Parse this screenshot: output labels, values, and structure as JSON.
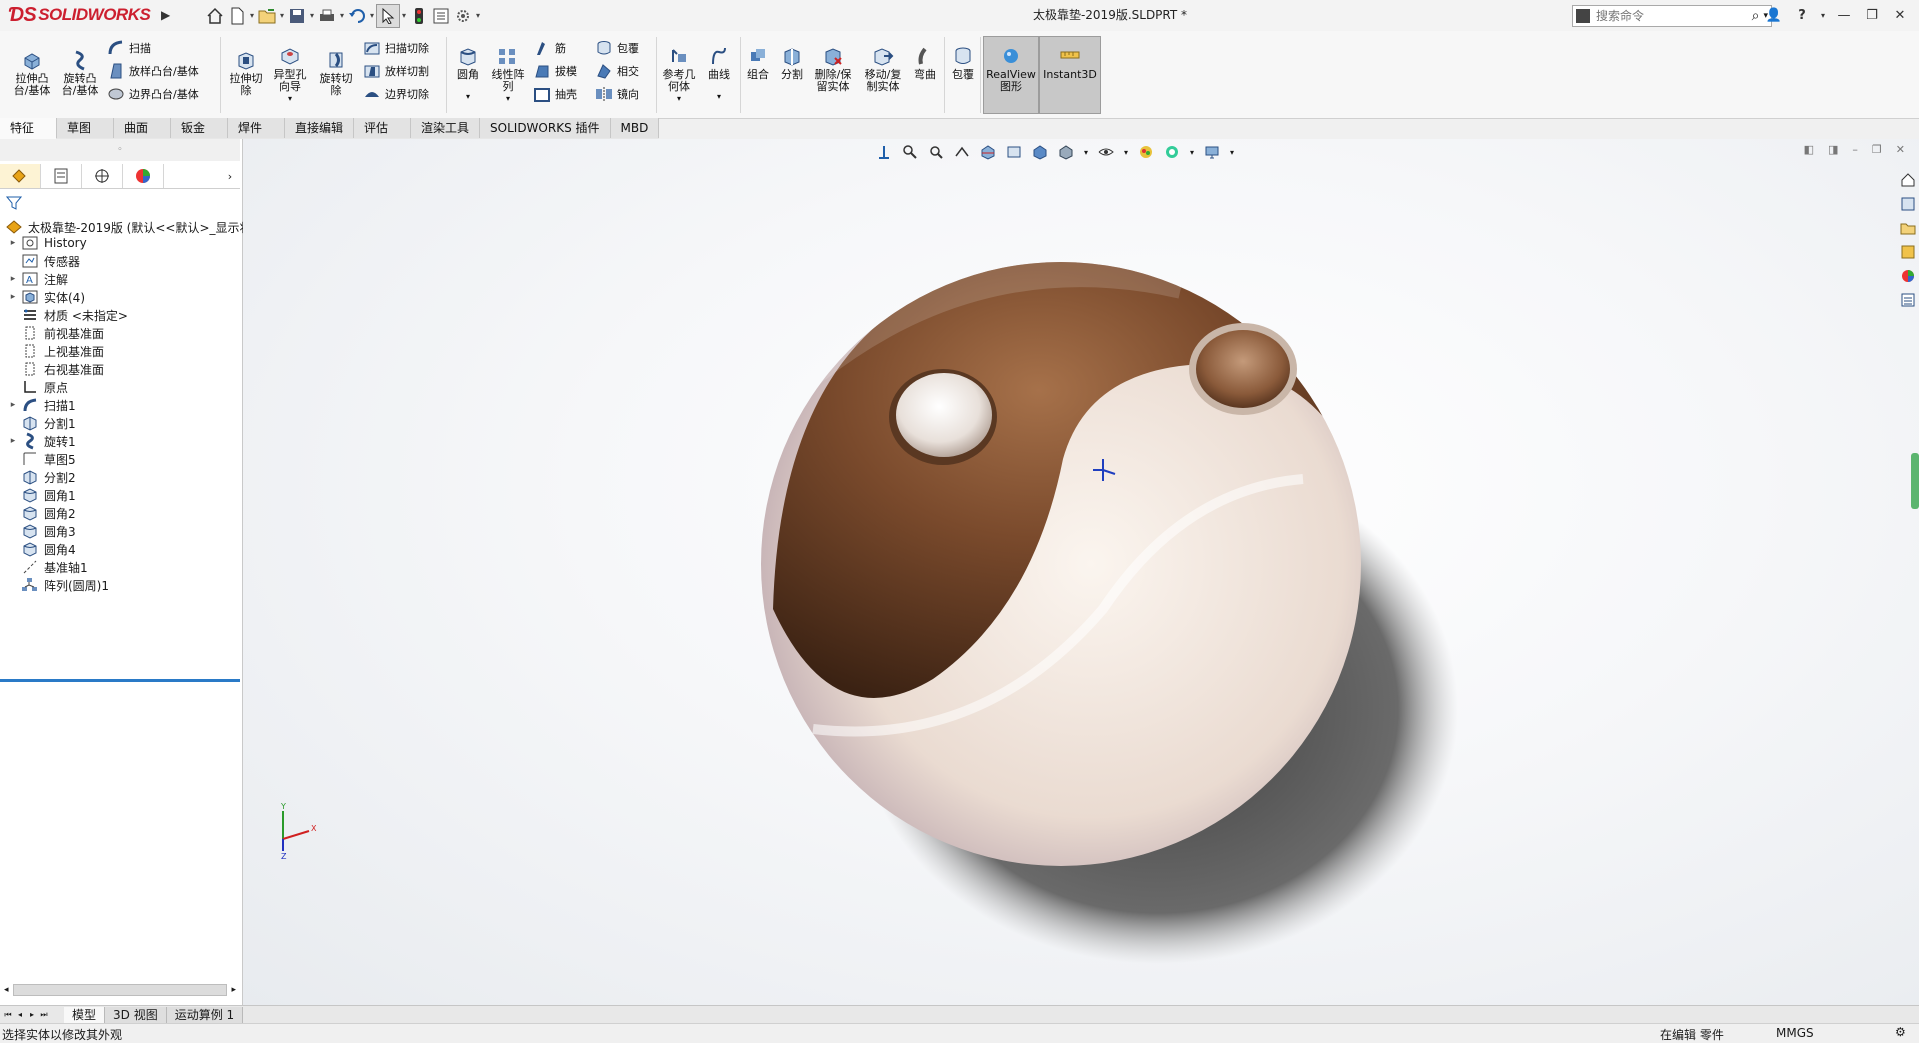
{
  "app": {
    "logo_text_solid": "SOLID",
    "logo_text_works": "WORKS",
    "document_title": "太极靠垫-2019版.SLDPRT *",
    "search_placeholder": "搜索命令"
  },
  "ribbon": {
    "extrude_boss": "拉伸凸\n台/基体",
    "revolve_boss": "旋转凸\n台/基体",
    "sweep": "扫描",
    "loft_boss": "放样凸台/基体",
    "boundary_boss": "边界凸台/基体",
    "extrude_cut": "拉伸切\n除",
    "hole_wizard": "异型孔\n向导",
    "revolve_cut": "旋转切\n除",
    "sweep_cut": "扫描切除",
    "loft_cut": "放样切割",
    "boundary_cut": "边界切除",
    "fillet": "圆角",
    "linear_pattern": "线性阵\n列",
    "rib": "筋",
    "draft": "拔模",
    "shell": "抽壳",
    "wrap": "包覆",
    "intersect": "相交",
    "mirror": "镜向",
    "ref_geometry": "参考几\n何体",
    "curves": "曲线",
    "combine": "组合",
    "split": "分割",
    "delete_keep_body": "删除/保\n留实体",
    "move_copy_body": "移动/复\n制实体",
    "flex": "弯曲",
    "wrap2": "包覆",
    "realview": "RealView\n图形",
    "instant3d": "Instant3D"
  },
  "tabs": [
    "特征",
    "草图",
    "曲面",
    "钣金",
    "焊件",
    "直接编辑",
    "评估",
    "渲染工具",
    "SOLIDWORKS 插件",
    "MBD"
  ],
  "tree": {
    "root": "太极靠垫-2019版  (默认<<默认>_显示状",
    "items": [
      {
        "label": "History",
        "expand": true,
        "icon": "history-icon"
      },
      {
        "label": "传感器",
        "expand": false,
        "icon": "sensor-icon"
      },
      {
        "label": "注解",
        "expand": true,
        "icon": "annotation-icon"
      },
      {
        "label": "实体(4)",
        "expand": true,
        "icon": "solid-bodies-icon"
      },
      {
        "label": "材质 <未指定>",
        "expand": false,
        "icon": "material-icon"
      },
      {
        "label": "前视基准面",
        "expand": false,
        "icon": "plane-icon"
      },
      {
        "label": "上视基准面",
        "expand": false,
        "icon": "plane-icon"
      },
      {
        "label": "右视基准面",
        "expand": false,
        "icon": "plane-icon"
      },
      {
        "label": "原点",
        "expand": false,
        "icon": "origin-icon"
      },
      {
        "label": "扫描1",
        "expand": true,
        "icon": "sweep-icon"
      },
      {
        "label": "分割1",
        "expand": false,
        "icon": "split-icon"
      },
      {
        "label": "旋转1",
        "expand": true,
        "icon": "revolve-icon"
      },
      {
        "label": "草图5",
        "expand": false,
        "icon": "sketch-icon"
      },
      {
        "label": "分割2",
        "expand": false,
        "icon": "split-icon"
      },
      {
        "label": "圆角1",
        "expand": false,
        "icon": "fillet-icon"
      },
      {
        "label": "圆角2",
        "expand": false,
        "icon": "fillet-icon"
      },
      {
        "label": "圆角3",
        "expand": false,
        "icon": "fillet-icon"
      },
      {
        "label": "圆角4",
        "expand": false,
        "icon": "fillet-icon"
      },
      {
        "label": "基准轴1",
        "expand": false,
        "icon": "axis-icon"
      },
      {
        "label": "阵列(圆周)1",
        "expand": false,
        "icon": "circular-pattern-icon"
      }
    ]
  },
  "bottom_tabs": [
    "模型",
    "3D 视图",
    "运动算例 1"
  ],
  "status": {
    "left": "选择实体以修改其外观",
    "editing": "在编辑 零件",
    "units": "MMGS"
  },
  "colors": {
    "brand_red": "#cc1f2f",
    "walnut": "#6b4226",
    "maple": "#efe4da",
    "tree_highlight": "#2a7ac7"
  }
}
